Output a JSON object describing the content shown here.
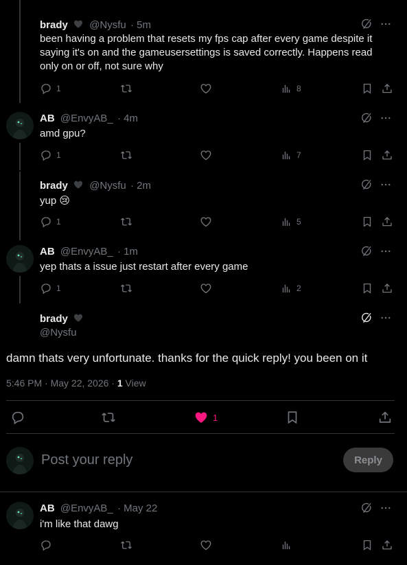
{
  "posts": [
    {
      "name": "brady",
      "handle": "@Nysfu",
      "time": "· 5m",
      "text": "been having a problem that resets my fps cap after every game despite it saying it's on and the gameusersettings is saved correctly. Happens read only on or off, not sure why",
      "replies": "1",
      "views": "8"
    },
    {
      "name": "AB",
      "handle": "@EnvyAB_",
      "time": "· 4m",
      "text": "amd gpu?",
      "replies": "1",
      "views": "7"
    },
    {
      "name": "brady",
      "handle": "@Nysfu",
      "time": "· 2m",
      "text": "yup 😢",
      "replies": "1",
      "views": "5"
    },
    {
      "name": "AB",
      "handle": "@EnvyAB_",
      "time": "· 1m",
      "text": "yep thats a issue just restart after every game",
      "replies": "1",
      "views": "2"
    }
  ],
  "main_post": {
    "name": "brady",
    "handle": "@Nysfu",
    "text": "damn thats very unfortunate. thanks for the quick reply! you been on it",
    "timestamp": "5:46 PM · May 22, 2026 · ",
    "view_count": "1",
    "view_label": " View",
    "likes": "1"
  },
  "compose": {
    "placeholder": "Post your reply",
    "button": "Reply"
  },
  "bottom_reply": {
    "name": "AB",
    "handle": "@EnvyAB_",
    "time": "· May 22",
    "text": "i'm like that dawg"
  },
  "colors": {
    "like_active": "#f91880",
    "muted": "#71767b",
    "text": "#e7e9ea"
  }
}
